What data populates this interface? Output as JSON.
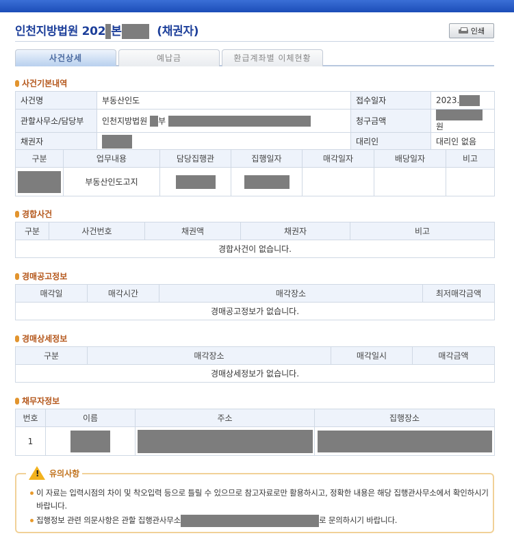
{
  "header": {
    "title_prefix": "인천지방법원 202",
    "title_mid": "본",
    "title_suffix": "(채권자)",
    "print_label": "인쇄"
  },
  "tabs": [
    "사건상세",
    "예납금",
    "환급계좌별 이체현황"
  ],
  "basic": {
    "section_title": "사건기본내역",
    "case_name_label": "사건명",
    "case_name": "부동산인도",
    "office_label": "관할사무소/담당부",
    "office_prefix": "인천지방법원",
    "office_mid": "부",
    "creditor_label": "채권자",
    "received_label": "접수일자",
    "received_value": "2023.",
    "claim_label": "청구금액",
    "claim_unit": "원",
    "agent_label": "대리인",
    "agent_value": "대리인 없음",
    "task_headers": [
      "구분",
      "업무내용",
      "담당집행관",
      "집행일자",
      "매각일자",
      "배당일자",
      "비고"
    ],
    "task_content": "부동산인도고지"
  },
  "competing": {
    "section_title": "경합사건",
    "headers": [
      "구분",
      "사건번호",
      "채권액",
      "채권자",
      "비고"
    ],
    "empty": "경합사건이 없습니다."
  },
  "auction_notice": {
    "section_title": "경매공고정보",
    "headers": [
      "매각일",
      "매각시간",
      "매각장소",
      "최저매각금액"
    ],
    "empty": "경매공고정보가 없습니다."
  },
  "auction_detail": {
    "section_title": "경매상세정보",
    "headers": [
      "구분",
      "매각장소",
      "매각일시",
      "매각금액"
    ],
    "empty": "경매상세정보가 없습니다."
  },
  "debtor": {
    "section_title": "채무자정보",
    "headers": [
      "번호",
      "이름",
      "주소",
      "집행장소"
    ],
    "row_no": "1"
  },
  "notice": {
    "title": "유의사항",
    "line1": "이 자료는 입력시점의 차이 및 착오입력 등으로 틀릴 수 있으므로 참고자료로만 활용하시고, 정확한 내용은 해당 집행관사무소에서 확인하시기 바랍니다.",
    "line2_prefix": "집행정보 관련 의문사항은 관할 집행관사무소",
    "line2_suffix": "로 문의하시기 바랍니다."
  },
  "colors": {
    "title": "#1d3f9a",
    "section": "#b4561a",
    "header_bg": "#eef3fb",
    "mask": "#7d7d7d",
    "accent": "#e89a2c"
  },
  "icons": [
    "printer-icon",
    "section-dot-icon",
    "warning-icon"
  ]
}
